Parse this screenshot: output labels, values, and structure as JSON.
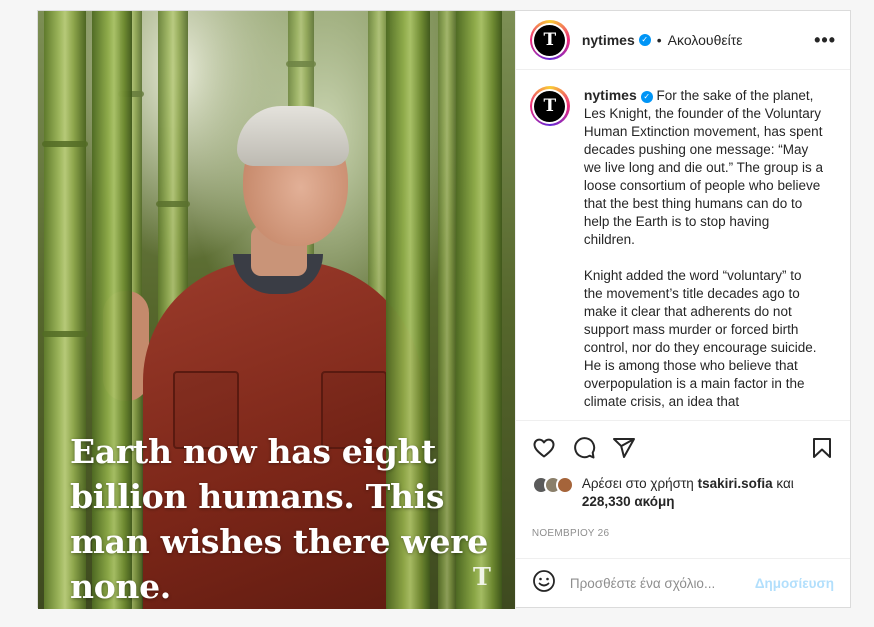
{
  "post": {
    "image": {
      "headline": "Earth now has eight billion humans. This man wishes there were none.",
      "logo": "T"
    },
    "header": {
      "username": "nytimes",
      "avatar_letter": "T",
      "separator": "•",
      "follow_label": "Ακολουθείτε",
      "more_label": "•••"
    },
    "caption": {
      "username": "nytimes",
      "paragraph1": "For the sake of the planet, Les Knight, the founder of the Voluntary Human Extinction movement, has spent decades pushing one message: “May we live long and die out.” The group is a loose consortium of people who believe that the best thing humans can do to help the Earth is to stop having children.",
      "paragraph2": "Knight added the word “voluntary” to the movement’s title decades ago to make it clear that adherents do not support mass murder or forced birth control, nor do they encourage suicide. He is among those who believe that overpopulation is a main factor in the climate crisis, an idea that"
    },
    "likes": {
      "prefix": "Αρέσει στο χρήστη",
      "user": "tsakiri.sofia",
      "conjunction": "και",
      "count": "228,330 ακόμη"
    },
    "date": "ΝΟΕΜΒΡΙΟΥ 26",
    "comment": {
      "placeholder": "Προσθέστε ένα σχόλιο...",
      "publish_label": "Δημοσίευση"
    },
    "colors": {
      "accent_blue": "#0095f6",
      "publish_disabled": "#b2dffc",
      "verified": "#0095f6"
    },
    "icons": [
      "heart-icon",
      "comment-icon",
      "share-icon",
      "bookmark-icon",
      "emoji-icon",
      "verified-icon",
      "more-icon"
    ]
  }
}
